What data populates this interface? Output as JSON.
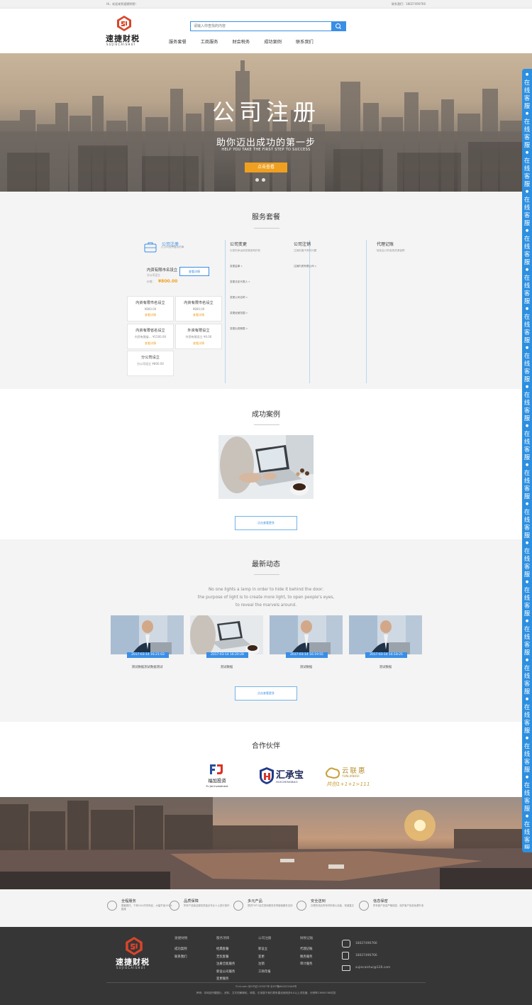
{
  "topbar": {
    "welcome": "Hi，欢迎来到速捷财税！",
    "contact": "联系我们：18027490766"
  },
  "brand": {
    "name": "速捷财税",
    "sub": "SUJIECAISHUI"
  },
  "search": {
    "placeholder": "请输入你查找的内容"
  },
  "nav": [
    "服务套餐",
    "工商服务",
    "财会税务",
    "成功案例",
    "联系我们"
  ],
  "banner": {
    "title": "公司注册",
    "subtitle": "助你迈出成功的第一步",
    "subtitle_en": "HELP YOU TAKE THE FIRST STEP TO SUCCESS",
    "button": "点击查看"
  },
  "services": {
    "title": "服务套餐",
    "col1": {
      "title": "公司注册",
      "sub": "让公司没有复杂的事",
      "featured": {
        "name": "内资有限市名设立",
        "note": "分公司设立",
        "price_label": "价格：",
        "price": "¥800.00",
        "button": "查看详情"
      },
      "items": [
        {
          "name": "内资有限市名设立",
          "price": "¥800.00",
          "link": "查看详情"
        },
        {
          "name": "内资有限市名设立",
          "price": "¥800.00",
          "link": "查看详情"
        },
        {
          "name": "内资有限省名设立",
          "price": "内资有限省... ¥1500.00",
          "link": "查看详情"
        },
        {
          "name": "外资有限设立",
          "price": "外资有限设立 ¥0.00",
          "link": "查看详情"
        },
        {
          "name": "分公司设立",
          "price": "分公司设立 ¥800.00",
          "link": "查看详情"
        }
      ]
    },
    "col2": {
      "title": "公司变更",
      "sub": "为您的命运和发展保驾护航",
      "links": [
        "变更监事 »",
        "变更法定代表人 »",
        "变更公司名称 »",
        "变更经营范围 »",
        "变更出资期限 »"
      ]
    },
    "col3": {
      "title": "公司注销",
      "sub": "注销依靠不再有问题",
      "links": [
        "注销内资有限公司 »"
      ]
    },
    "col4": {
      "title": "代理记账",
      "sub": "轻松会计的各类资源保障"
    }
  },
  "cases": {
    "title": "成功案例",
    "more": "点击查看更多"
  },
  "news": {
    "title": "最新动态",
    "quote": [
      "No one lights a lamp in order to hide it behind the door:",
      "the purpose of light is to create more light, to open people’s eyes,",
      "to reveal the marvels around."
    ],
    "items": [
      {
        "date": "2017-03-14 16:21:03",
        "caption": "测试数据测试数据测试"
      },
      {
        "date": "2017-03-14 16:20:28",
        "caption": "测试数据"
      },
      {
        "date": "2017-03-14 16:19:55",
        "caption": "测试数据"
      },
      {
        "date": "2017-03-14 16:18:25",
        "caption": "测试数据"
      }
    ],
    "more": "点击查看更多"
  },
  "partners": {
    "title": "合作伙伴",
    "items": [
      {
        "logo": "FJ",
        "cn": "福加投资",
        "en": "Fu Jia Investment"
      },
      {
        "logo": "HC",
        "cn": "汇承宝",
        "en": "HUICHENGBAO"
      },
      {
        "logo": "YL",
        "cn": "云联惠",
        "en": "YUNLIANHUI",
        "tag": "共创1+1+1>111"
      }
    ]
  },
  "features": [
    {
      "icon": "user-icon",
      "title": "全程服务",
      "desc": "整套委托，下单24小时内响应，大幅节省100%困难"
    },
    {
      "icon": "shield-icon",
      "title": "品质保障",
      "desc": "所有产品保证服务质量合专业人士进行操作"
    },
    {
      "icon": "layers-icon",
      "title": "多元产品",
      "desc": "提供TMT1站式咨询服务多项增值服务支持"
    },
    {
      "icon": "truck-icon",
      "title": "安全送到",
      "desc": "办理完成后所有材料精心包装，快递直达"
    },
    {
      "icon": "lock-icon",
      "title": "信息保密",
      "desc": "所有客户信息严格保密，保护客户信息免遭外泄"
    }
  ],
  "footer": {
    "cols": [
      {
        "title": "速捷财税",
        "items": [
          "成功案例",
          "联系我们"
        ]
      },
      {
        "title": "服务项目",
        "items": [
          "经典套餐",
          "无忧套餐",
          "注册全能服务",
          "新设公司服务",
          "变更服务"
        ]
      },
      {
        "title": "公司注册",
        "items": [
          "新设立",
          "变更",
          "注销",
          "工商年报"
        ]
      },
      {
        "title": "财税记账",
        "items": [
          "代理记账",
          "税务服务",
          "审计服务"
        ]
      }
    ],
    "phone1": "18027490766",
    "phone2": "18027490766",
    "email": "sujiecaishui@126.com",
    "icp": "©mi.com 京ICP证110507号 京ICP备644222444号",
    "statement": "声明：本网站所展图片、资料、文字的解释权、转载、引用属于我们原来建设使用多8.0以上浏览器，分辨率1366X768浏览"
  },
  "side": {
    "text": "在线客服"
  },
  "colors": {
    "accent": "#3a8ee6",
    "orange": "#f0a020",
    "footer": "#363636"
  }
}
